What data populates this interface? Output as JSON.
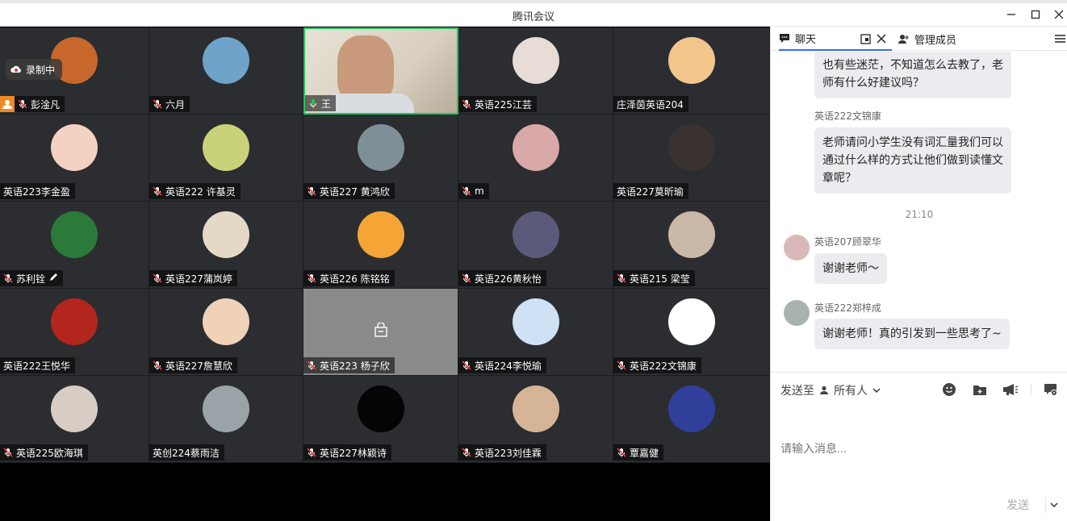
{
  "window": {
    "title": "腾讯会议"
  },
  "recording": {
    "label": "录制中"
  },
  "tiles": [
    {
      "name": "彭淦凡",
      "avatar": "#c8672c",
      "host": true,
      "mic": "muted"
    },
    {
      "name": "六月",
      "avatar": "#6fa3c9",
      "mic": "muted"
    },
    {
      "name": "王",
      "avatar": "",
      "mic": "on",
      "speaking": true,
      "camera": true
    },
    {
      "name": "英语225江芸",
      "avatar": "#e8dcd6",
      "mic": "muted"
    },
    {
      "name": "庄泽茵英语204",
      "avatar": "#f2c58a",
      "mic": "none"
    },
    {
      "name": "英语223李金盈",
      "avatar": "#f3d2c1",
      "mic": "none"
    },
    {
      "name": "英语222 许基灵",
      "avatar": "#c9d27a",
      "mic": "muted"
    },
    {
      "name": "英语227 黄鸿欣",
      "avatar": "#7f8f98",
      "mic": "muted"
    },
    {
      "name": "m",
      "avatar": "#d9a8a8",
      "mic": "muted"
    },
    {
      "name": "英语227莫昕瑜",
      "avatar": "#3a3230",
      "mic": "none"
    },
    {
      "name": "苏利铨",
      "avatar": "#2c7a3a",
      "mic": "muted",
      "pen": true
    },
    {
      "name": "英语227蒲岚婷",
      "avatar": "#e4d8c7",
      "mic": "muted"
    },
    {
      "name": "英语226 陈铭铭",
      "avatar": "#f4a536",
      "mic": "muted"
    },
    {
      "name": "英语226黄秋怡",
      "avatar": "#5b5a7a",
      "mic": "muted"
    },
    {
      "name": "英语215 梁莹",
      "avatar": "#c9b7a8",
      "mic": "muted"
    },
    {
      "name": "英语222王悦华",
      "avatar": "#b3261e",
      "mic": "none"
    },
    {
      "name": "英语227詹慧欣",
      "avatar": "#f0d2b8",
      "mic": "muted"
    },
    {
      "name": "英语223 杨子欣",
      "avatar": "",
      "mic": "muted",
      "novideo": true
    },
    {
      "name": "英语224李悦瑜",
      "avatar": "#cfe2f5",
      "mic": "muted"
    },
    {
      "name": "英语222文锦康",
      "avatar": "#ffffff",
      "mic": "muted"
    },
    {
      "name": "英语225欧海琪",
      "avatar": "#d7cdc4",
      "mic": "muted"
    },
    {
      "name": "英创224蔡雨洁",
      "avatar": "#9aa3a8",
      "mic": "none"
    },
    {
      "name": "英语227林颖诗",
      "avatar": "#050505",
      "mic": "muted"
    },
    {
      "name": "英语223刘佳霖",
      "avatar": "#d6b597",
      "mic": "muted"
    },
    {
      "name": "覃嘉健",
      "avatar": "#2f3f9a",
      "mic": "muted"
    }
  ],
  "panel": {
    "tab_chat": "聊天",
    "tab_members": "管理成员"
  },
  "messages": [
    {
      "text1": "也有些迷茫，不知道怎么去教了，老",
      "text2": "师有什么好建议吗？"
    },
    {
      "sender": "英语222文锦康",
      "text1": "老师请问小学生没有词汇量我们可以",
      "text2": "通过什么样的方式让他们做到读懂文",
      "text3": "章呢？"
    },
    {
      "time": "21:10"
    },
    {
      "sender": "英语207顾翠华",
      "text": "谢谢老师～"
    },
    {
      "sender": "英语222郑梓成",
      "text": "谢谢老师！真的引发到一些思考了~"
    }
  ],
  "composer": {
    "send_to_label": "发送至",
    "recipient": "所有人",
    "placeholder": "请输入消息...",
    "send_label": "发送"
  }
}
